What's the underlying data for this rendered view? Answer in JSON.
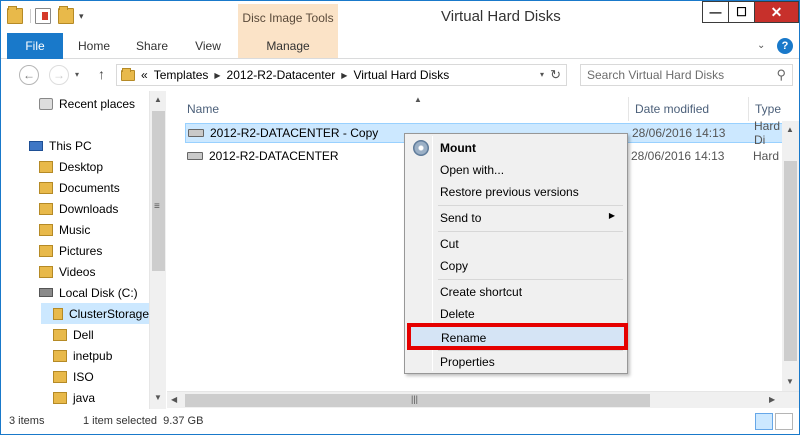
{
  "window": {
    "title": "Virtual Hard Disks",
    "contextual_tab_group": "Disc Image Tools",
    "buttons": {
      "minimize": "—",
      "maximize": "☐",
      "close": "✕"
    }
  },
  "ribbon": {
    "tabs": [
      "File",
      "Home",
      "Share",
      "View",
      "Manage"
    ],
    "help": "?"
  },
  "address": {
    "overflow": "«",
    "breadcrumbs": [
      "Templates",
      "2012-R2-Datacenter",
      "Virtual Hard Disks"
    ],
    "search_placeholder": "Search Virtual Hard Disks"
  },
  "nav": {
    "items": [
      {
        "label": "Recent places",
        "icon": "recent-places-icon"
      },
      {
        "label": "This PC",
        "icon": "computer-icon"
      },
      {
        "label": "Desktop",
        "icon": "desktop-folder-icon"
      },
      {
        "label": "Documents",
        "icon": "documents-folder-icon"
      },
      {
        "label": "Downloads",
        "icon": "downloads-folder-icon"
      },
      {
        "label": "Music",
        "icon": "music-folder-icon"
      },
      {
        "label": "Pictures",
        "icon": "pictures-folder-icon"
      },
      {
        "label": "Videos",
        "icon": "videos-folder-icon"
      },
      {
        "label": "Local Disk (C:)",
        "icon": "local-disk-icon"
      },
      {
        "label": "ClusterStorage",
        "icon": "folder-icon"
      },
      {
        "label": "Dell",
        "icon": "folder-icon"
      },
      {
        "label": "inetpub",
        "icon": "folder-icon"
      },
      {
        "label": "ISO",
        "icon": "folder-icon"
      },
      {
        "label": "java",
        "icon": "folder-icon"
      }
    ],
    "selected": "ClusterStorage"
  },
  "content": {
    "columns": [
      "Name",
      "Date modified",
      "Type"
    ],
    "files": [
      {
        "name": "2012-R2-DATACENTER - Copy",
        "date": "28/06/2016 14:13",
        "type": "Hard Di",
        "selected": true
      },
      {
        "name": "2012-R2-DATACENTER",
        "date": "28/06/2016 14:13",
        "type": "Hard Di",
        "selected": false
      }
    ]
  },
  "context_menu": {
    "items": [
      {
        "label": "Mount",
        "bold": true
      },
      {
        "label": "Open with..."
      },
      {
        "label": "Restore previous versions"
      },
      {
        "label": "Send to",
        "submenu": true
      },
      {
        "label": "Cut"
      },
      {
        "label": "Copy"
      },
      {
        "label": "Create shortcut"
      },
      {
        "label": "Delete"
      },
      {
        "label": "Rename",
        "highlighted": true
      },
      {
        "label": "Properties"
      }
    ],
    "highlight_color": "#e50000"
  },
  "status": {
    "item_count": "3 items",
    "selection": "1 item selected  9.37 GB"
  },
  "colors": {
    "accent": "#1979ca",
    "contextual_tab": "#fbe3c7",
    "selection": "#cce8ff",
    "close_button": "#c7302b"
  }
}
